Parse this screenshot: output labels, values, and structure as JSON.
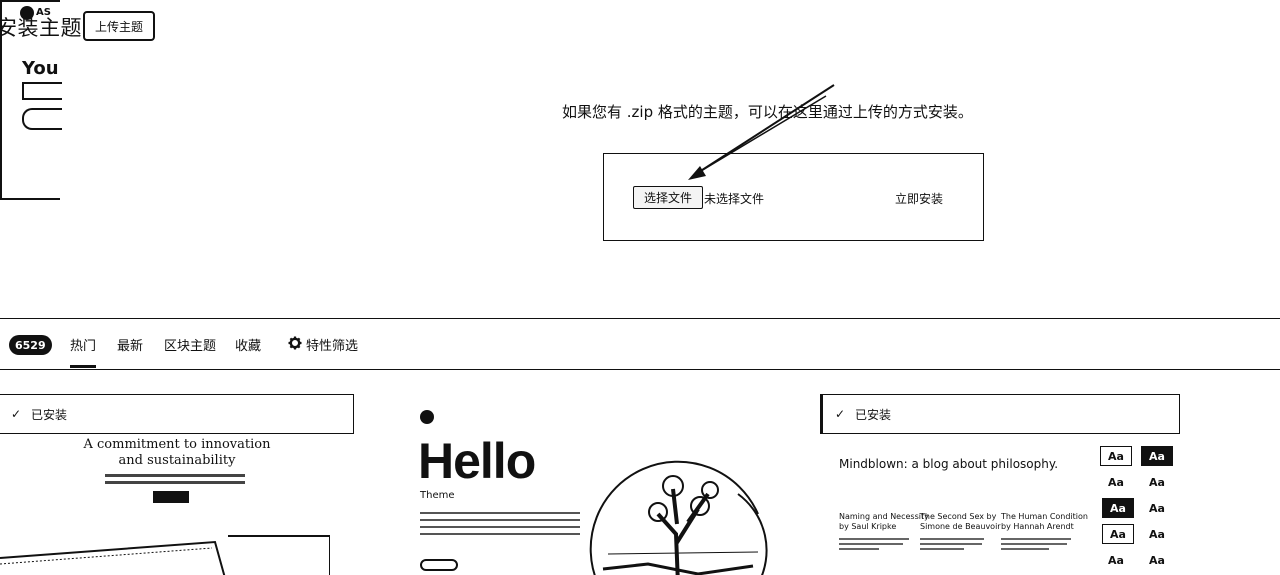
{
  "header": {
    "title": "安装主题",
    "upload_button": "上传主题"
  },
  "upload": {
    "help_text": "如果您有 .zip 格式的主题，可以在这里通过上传的方式安装。",
    "choose_file": "选择文件",
    "no_file": "未选择文件",
    "install_now": "立即安装"
  },
  "filter": {
    "count": "6529",
    "tabs": [
      "热门",
      "最新",
      "区块主题",
      "收藏"
    ],
    "feature_filter": "特性筛选"
  },
  "cards": {
    "installed_label": "已安装",
    "card1": {
      "heading": "A commitment to innovation and sustainability"
    },
    "card2": {
      "hello": "Hello",
      "subtitle": "Theme"
    },
    "card3": {
      "title": "Mindblown: a blog about philosophy.",
      "posts": [
        {
          "title": "Naming and Necessity",
          "byline": "by Saul Kripke"
        },
        {
          "title": "The Second Sex by",
          "byline": "Simone de Beauvoir"
        },
        {
          "title": "The Human Condition",
          "byline": "by Hannah Arendt"
        }
      ],
      "aa": "Aa"
    },
    "card4": {
      "brand": "AS",
      "big": "You"
    }
  }
}
